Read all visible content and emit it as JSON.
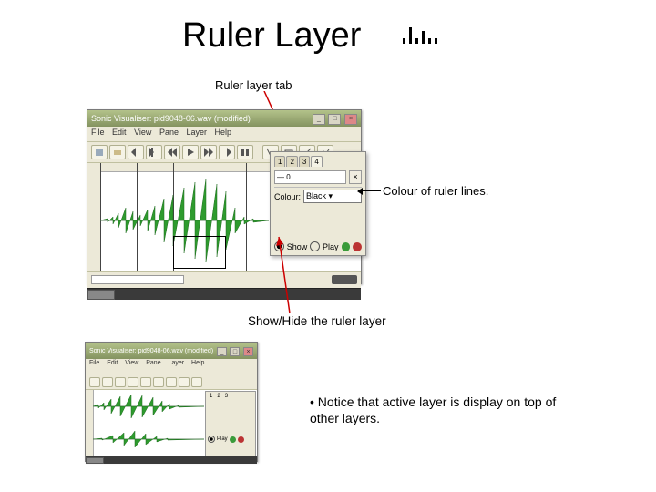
{
  "title": "Ruler Layer",
  "labels": {
    "tab": "Ruler layer tab",
    "colour": "Colour of ruler lines.",
    "showhide": "Show/Hide the ruler layer"
  },
  "bullet": "• Notice that active layer is display on top of other layers.",
  "app": {
    "title": "Sonic Visualiser: pid9048-06.wav (modified)",
    "title2": "Sonic Visualiser: pid9048-06.wav (modified)",
    "menu": [
      "File",
      "Edit",
      "View",
      "Pane",
      "Layer",
      "Help"
    ],
    "panel": {
      "tabs": [
        "1",
        "2",
        "3",
        "4"
      ],
      "colour_label": "Colour:",
      "colour_value": "Black",
      "show_label": "Show",
      "play_label": "Play"
    }
  }
}
